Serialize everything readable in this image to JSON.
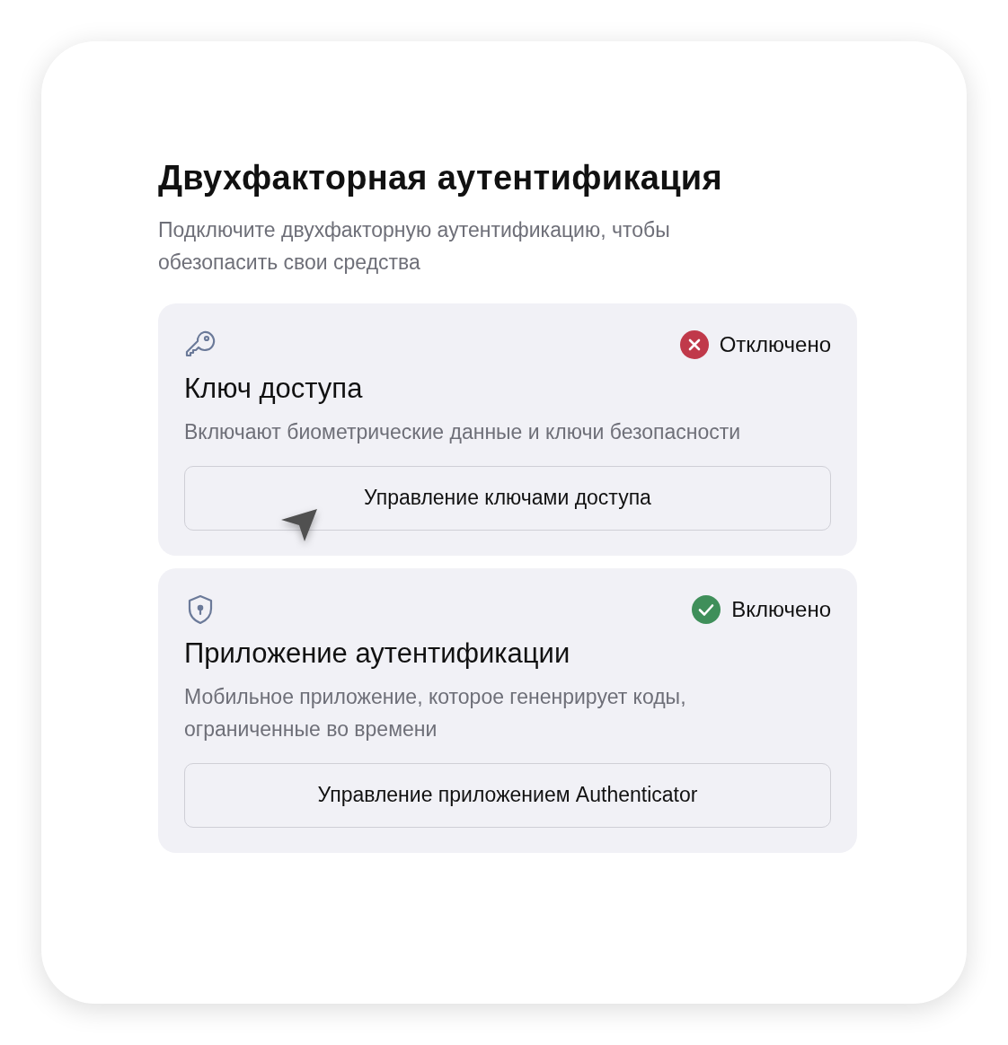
{
  "title": "Двухфакторная аутентификация",
  "subtitle": "Подключите двухфакторную аутентификацию, чтобы обезопасить свои средства",
  "methods": [
    {
      "kind": "key",
      "status": "Отключено",
      "enabled": false,
      "name": "Ключ доступа",
      "description": "Включают биометрические данные и ключи безопасности",
      "button": "Управление ключами доступа"
    },
    {
      "kind": "shield",
      "status": "Включено",
      "enabled": true,
      "name": "Приложение аутентификации",
      "description": "Мобильное приложение, которое гененрирует коды, ограниченные во времени",
      "button": "Управление приложением Authenticator"
    }
  ]
}
